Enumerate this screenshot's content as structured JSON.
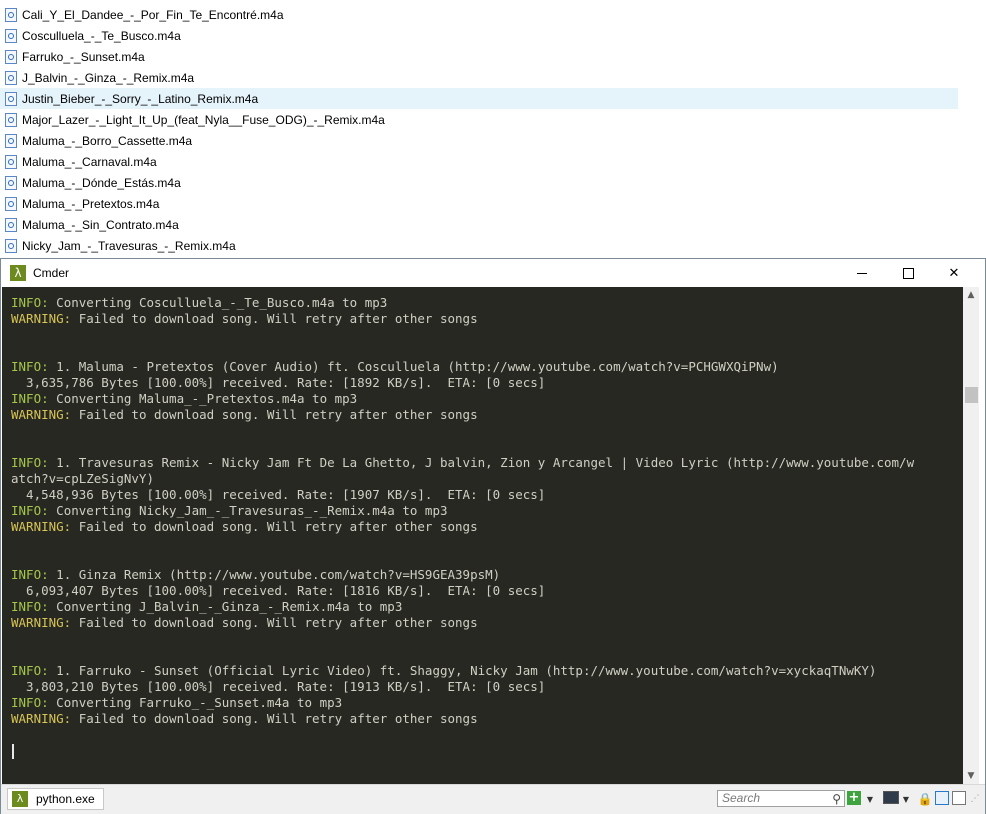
{
  "explorer": {
    "files": [
      {
        "name": "Cali_Y_El_Dandee_-_Por_Fin_Te_Encontré.m4a",
        "selected": false
      },
      {
        "name": "Cosculluela_-_Te_Busco.m4a",
        "selected": false
      },
      {
        "name": "Farruko_-_Sunset.m4a",
        "selected": false
      },
      {
        "name": "J_Balvin_-_Ginza_-_Remix.m4a",
        "selected": false
      },
      {
        "name": "Justin_Bieber_-_Sorry_-_Latino_Remix.m4a",
        "selected": true
      },
      {
        "name": "Major_Lazer_-_Light_It_Up_(feat_Nyla__Fuse_ODG)_-_Remix.m4a",
        "selected": false
      },
      {
        "name": "Maluma_-_Borro_Cassette.m4a",
        "selected": false
      },
      {
        "name": "Maluma_-_Carnaval.m4a",
        "selected": false
      },
      {
        "name": "Maluma_-_Dónde_Estás.m4a",
        "selected": false
      },
      {
        "name": "Maluma_-_Pretextos.m4a",
        "selected": false
      },
      {
        "name": "Maluma_-_Sin_Contrato.m4a",
        "selected": false
      },
      {
        "name": "Nicky_Jam_-_Travesuras_-_Remix.m4a",
        "selected": false
      }
    ]
  },
  "window": {
    "title": "Cmder",
    "app_icon": "lambda-icon",
    "controls": {
      "minimize": "minimize-icon",
      "maximize": "maximize-icon",
      "close": "close-icon"
    }
  },
  "console": {
    "lines": [
      {
        "tag": "INFO:",
        "kind": "info",
        "text": " Converting Cosculluela_-_Te_Busco.m4a to mp3"
      },
      {
        "tag": "WARNING:",
        "kind": "warn",
        "text": " Failed to download song. Will retry after other songs"
      },
      {
        "tag": "",
        "kind": "plain",
        "text": ""
      },
      {
        "tag": "",
        "kind": "plain",
        "text": ""
      },
      {
        "tag": "INFO:",
        "kind": "info",
        "text": " 1. Maluma - Pretextos (Cover Audio) ft. Cosculluela (http://www.youtube.com/watch?v=PCHGWXQiPNw)"
      },
      {
        "tag": "",
        "kind": "plain",
        "text": "  3,635,786 Bytes [100.00%] received. Rate: [1892 KB/s].  ETA: [0 secs]"
      },
      {
        "tag": "INFO:",
        "kind": "info",
        "text": " Converting Maluma_-_Pretextos.m4a to mp3"
      },
      {
        "tag": "WARNING:",
        "kind": "warn",
        "text": " Failed to download song. Will retry after other songs"
      },
      {
        "tag": "",
        "kind": "plain",
        "text": ""
      },
      {
        "tag": "",
        "kind": "plain",
        "text": ""
      },
      {
        "tag": "INFO:",
        "kind": "info",
        "text": " 1. Travesuras Remix - Nicky Jam Ft De La Ghetto, J balvin, Zion y Arcangel | Video Lyric (http://www.youtube.com/w"
      },
      {
        "tag": "",
        "kind": "plain",
        "text": "atch?v=cpLZeSigNvY)"
      },
      {
        "tag": "",
        "kind": "plain",
        "text": "  4,548,936 Bytes [100.00%] received. Rate: [1907 KB/s].  ETA: [0 secs]"
      },
      {
        "tag": "INFO:",
        "kind": "info",
        "text": " Converting Nicky_Jam_-_Travesuras_-_Remix.m4a to mp3"
      },
      {
        "tag": "WARNING:",
        "kind": "warn",
        "text": " Failed to download song. Will retry after other songs"
      },
      {
        "tag": "",
        "kind": "plain",
        "text": ""
      },
      {
        "tag": "",
        "kind": "plain",
        "text": ""
      },
      {
        "tag": "INFO:",
        "kind": "info",
        "text": " 1. Ginza Remix (http://www.youtube.com/watch?v=HS9GEA39psM)"
      },
      {
        "tag": "",
        "kind": "plain",
        "text": "  6,093,407 Bytes [100.00%] received. Rate: [1816 KB/s].  ETA: [0 secs]"
      },
      {
        "tag": "INFO:",
        "kind": "info",
        "text": " Converting J_Balvin_-_Ginza_-_Remix.m4a to mp3"
      },
      {
        "tag": "WARNING:",
        "kind": "warn",
        "text": " Failed to download song. Will retry after other songs"
      },
      {
        "tag": "",
        "kind": "plain",
        "text": ""
      },
      {
        "tag": "",
        "kind": "plain",
        "text": ""
      },
      {
        "tag": "INFO:",
        "kind": "info",
        "text": " 1. Farruko - Sunset (Official Lyric Video) ft. Shaggy, Nicky Jam (http://www.youtube.com/watch?v=xyckaqTNwKY)"
      },
      {
        "tag": "",
        "kind": "plain",
        "text": "  3,803,210 Bytes [100.00%] received. Rate: [1913 KB/s].  ETA: [0 secs]"
      },
      {
        "tag": "INFO:",
        "kind": "info",
        "text": " Converting Farruko_-_Sunset.m4a to mp3"
      },
      {
        "tag": "WARNING:",
        "kind": "warn",
        "text": " Failed to download song. Will retry after other songs"
      }
    ]
  },
  "statusbar": {
    "tab_label": "python.exe",
    "search_placeholder": "Search"
  },
  "colors": {
    "console_bg": "#272822",
    "info": "#a6c64a",
    "warning": "#d6c355",
    "text": "#cfcfc2",
    "selection": "#e5f3fb"
  }
}
